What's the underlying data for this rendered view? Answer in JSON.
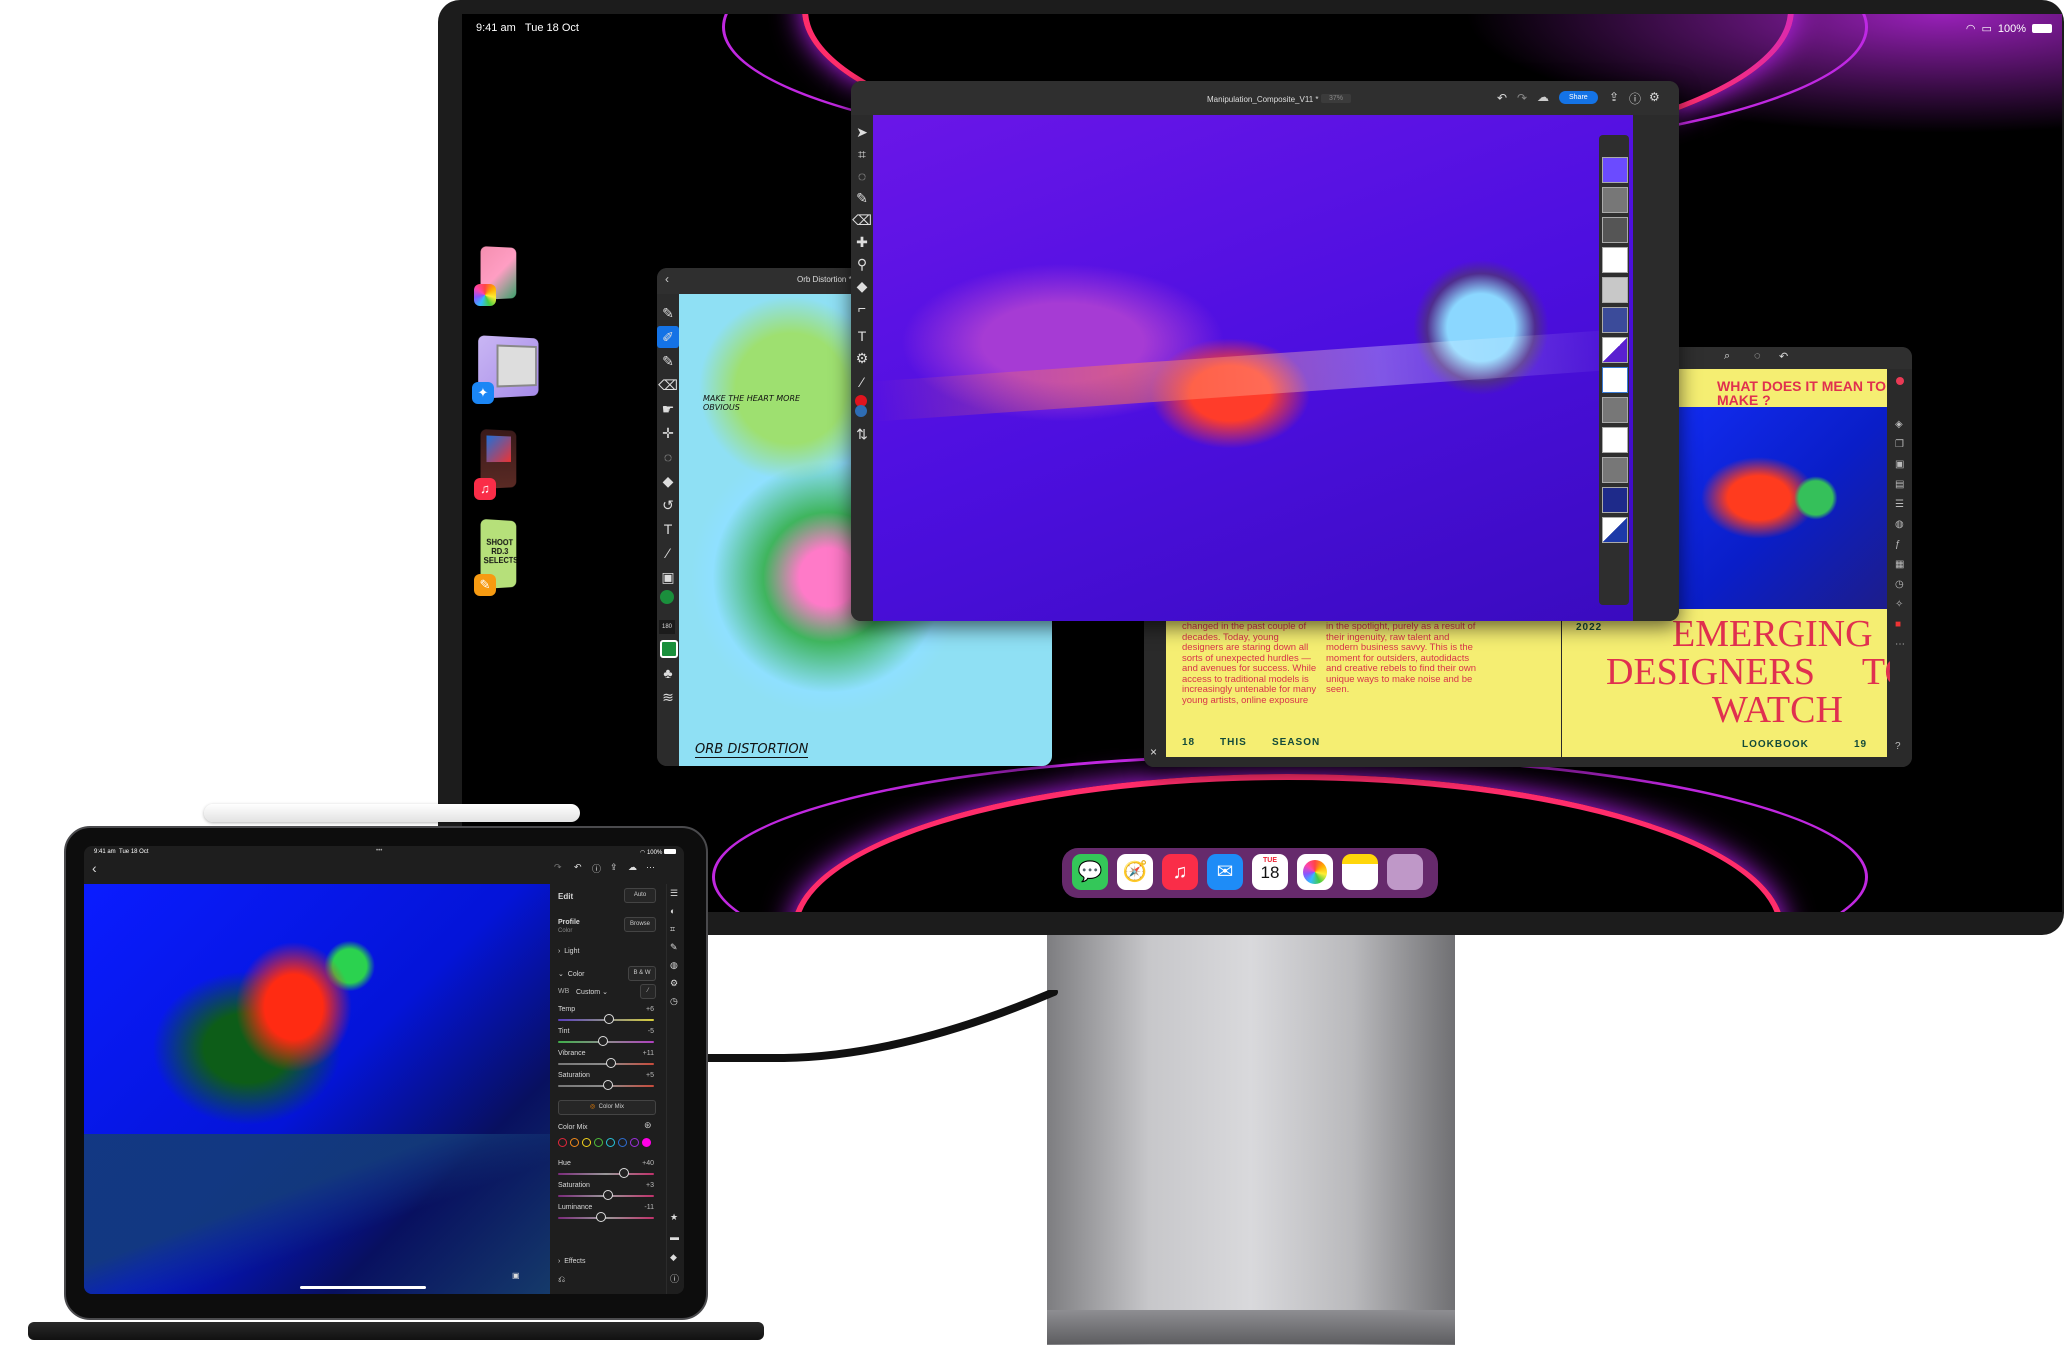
{
  "monitor": {
    "status_bar": {
      "time": "9:41 am",
      "date": "Tue 18 Oct",
      "battery": "100%"
    },
    "stage_manager": [
      {
        "name": "Photos",
        "badge_icon": "photos-icon"
      },
      {
        "name": "Safari",
        "badge_icon": "safari-icon"
      },
      {
        "name": "Music",
        "badge_icon": "music-icon"
      },
      {
        "name": "Pages",
        "badge_icon": "pages-icon",
        "thumb_text": "SHOOT RD.3 SELECTS"
      }
    ],
    "photoshop": {
      "multitask_dots": "•••",
      "file_name": "Manipulation_Composite_V11 *",
      "zoom": "37%",
      "share_label": "Share",
      "accent": "#1473e6",
      "tools": [
        "move",
        "transform",
        "lasso",
        "brush",
        "eraser",
        "healing",
        "dodge",
        "fill",
        "crop",
        "type",
        "content-aware",
        "eyedropper",
        "foreground-color",
        "background-color",
        "more"
      ],
      "foreground_color": "#e0141e",
      "background_color": "#2e6db4"
    },
    "fresco": {
      "title": "Orb Distortion *",
      "handwritten_note": "MAKE THE HEART MORE OBVIOUS",
      "caption": "ORB DISTORTION",
      "brush_size": "180",
      "current_color": "#1a8f3c"
    },
    "indesign": {
      "close_label": "×",
      "left_page": {
        "col1": "In the not too distant past, an aspiring designer would go to school, train under an apprentice, and work for a fashion house or atelier to establish a career. But a lot has changed in the past couple of decades. Today, young designers are staring down all sorts of unexpected hurdles — and avenues for success. While access to traditional models is increasingly untenable for many young artists, online exposure",
        "col2": "can send an emerging designer skyrocketing towards success overnight. At home with a sewing machine, upcycled materials and a DIY sensibility, self-taught designers are having their moment in the spotlight, purely as a result of their ingenuity, raw talent and modern business savvy. This is the moment for outsiders, autodidacts and creative rebels to find their own unique ways to make noise and be seen.",
        "footer": [
          "18",
          "THIS",
          "SEASON"
        ]
      },
      "right_page": {
        "kicker": "WHAT DOES IT MEAN TO MAKE ?",
        "year": "2022",
        "headline_lines": [
          "EMERGING",
          "DESIGNERS     TO",
          "WATCH"
        ],
        "footer": [
          "LOOKBOOK",
          "19"
        ]
      }
    },
    "dock": [
      {
        "app": "Messages",
        "icon": "messages-icon"
      },
      {
        "app": "Safari",
        "icon": "safari-icon"
      },
      {
        "app": "Music",
        "icon": "music-icon"
      },
      {
        "app": "Mail",
        "icon": "mail-icon"
      },
      {
        "app": "Calendar",
        "icon": "calendar-icon",
        "day": "TUE",
        "date": "18"
      },
      {
        "app": "Photos",
        "icon": "photos-icon"
      },
      {
        "app": "Notes",
        "icon": "notes-icon"
      },
      {
        "app": "App Library",
        "icon": "app-folder-icon"
      }
    ]
  },
  "ipad": {
    "status_bar": {
      "time": "9:41 am",
      "date": "Tue 18 Oct",
      "battery": "100%",
      "dots": "•••"
    },
    "lightroom": {
      "edit_title": "Edit",
      "auto_label": "Auto",
      "profile_label": "Profile",
      "profile_value": "Color",
      "browse_label": "Browse",
      "light_section": "Light",
      "color_section": "Color",
      "bw_label": "B & W",
      "wb_label": "WB",
      "wb_value": "Custom",
      "sliders": [
        {
          "name": "Temp",
          "value": "+6",
          "position": 0.53
        },
        {
          "name": "Tint",
          "value": "-5",
          "position": 0.47
        },
        {
          "name": "Vibrance",
          "value": "+11",
          "position": 0.55
        },
        {
          "name": "Saturation",
          "value": "+5",
          "position": 0.52
        }
      ],
      "color_mix_button": "Color Mix",
      "color_mix_label": "Color Mix",
      "mix_colors": [
        "#e0263b",
        "#f08a1c",
        "#f2d21c",
        "#4dbb3c",
        "#28c1d8",
        "#2e6dd0",
        "#9a2fd8",
        "#ff00e6"
      ],
      "selected_mix_color_index": 7,
      "mix_sliders": [
        {
          "name": "Hue",
          "value": "+40",
          "position": 0.69
        },
        {
          "name": "Saturation",
          "value": "+3",
          "position": 0.52
        },
        {
          "name": "Luminance",
          "value": "-11",
          "position": 0.45
        }
      ],
      "effects_section": "Effects"
    }
  }
}
